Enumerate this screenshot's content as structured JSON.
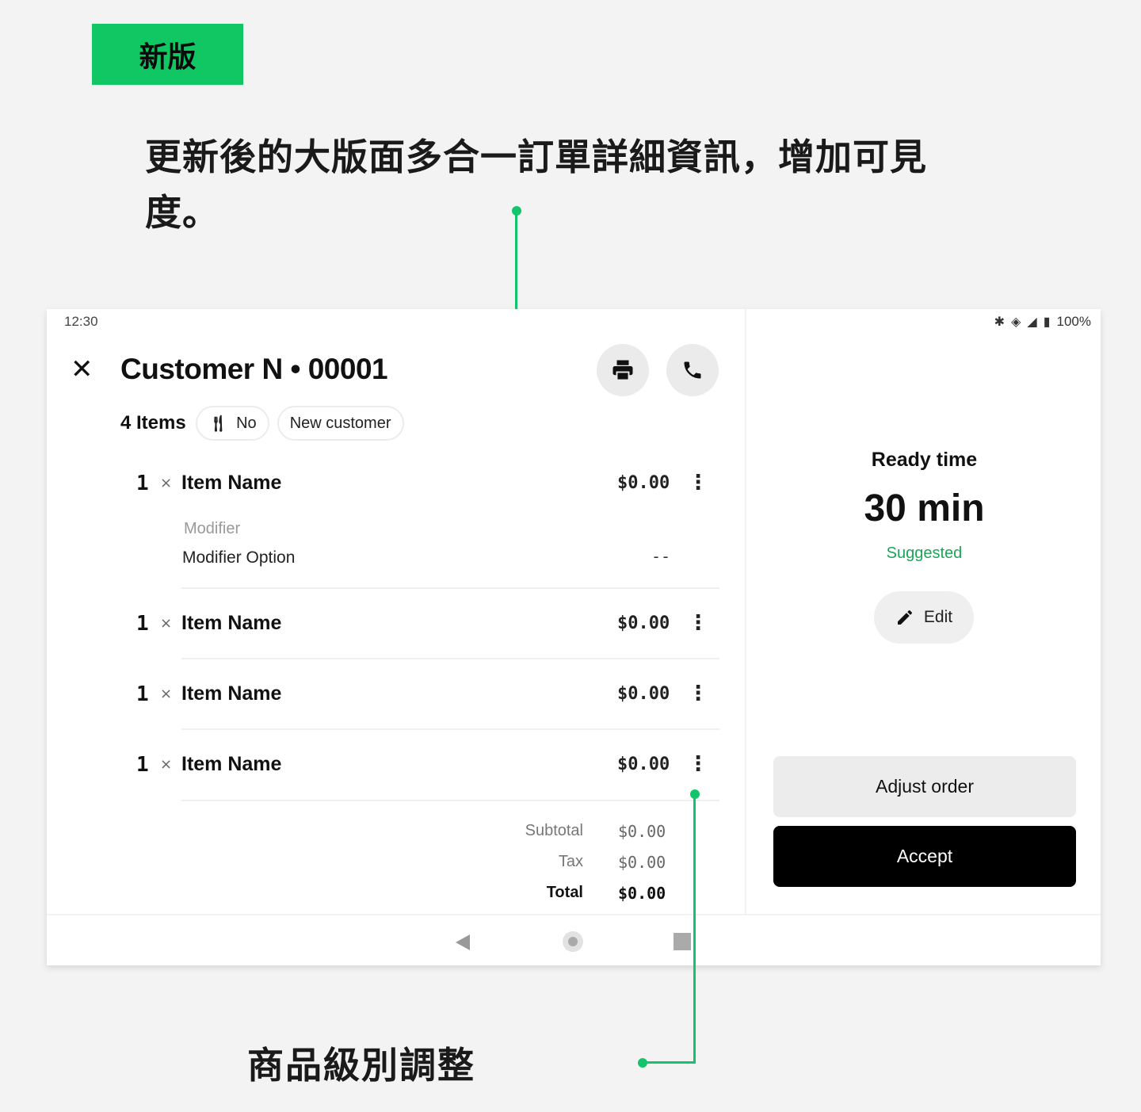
{
  "badge": "新版",
  "headline": "更新後的大版面多合一訂單詳細資訊，增加可見度。",
  "caption": "商品級別調整",
  "status_bar": {
    "time": "12:30",
    "battery": "100%"
  },
  "order": {
    "title": "Customer N • 00001",
    "items_count": "4 Items",
    "utensils_label": "No",
    "customer_tag": "New customer",
    "items": [
      {
        "qty": "1",
        "times": "×",
        "name": "Item Name",
        "price": "$0.00",
        "menu": "⋮"
      },
      {
        "qty": "1",
        "times": "×",
        "name": "Item Name",
        "price": "$0.00",
        "menu": "⋮"
      },
      {
        "qty": "1",
        "times": "×",
        "name": "Item Name",
        "price": "$0.00",
        "menu": "⋮"
      },
      {
        "qty": "1",
        "times": "×",
        "name": "Item Name",
        "price": "$0.00",
        "menu": "⋮"
      }
    ],
    "modifier": {
      "label": "Modifier",
      "option": "Modifier Option",
      "price": "--"
    },
    "summary": {
      "subtotal_label": "Subtotal",
      "subtotal": "$0.00",
      "tax_label": "Tax",
      "tax": "$0.00",
      "total_label": "Total",
      "total": "$0.00"
    }
  },
  "ready": {
    "label": "Ready time",
    "value": "30 min",
    "suggested": "Suggested",
    "edit_label": "Edit"
  },
  "actions": {
    "adjust": "Adjust order",
    "accept": "Accept"
  },
  "colors": {
    "accent_green": "#11c763",
    "suggested_green": "#1aa55a",
    "accept_bg": "#000000"
  },
  "icons": [
    "close-icon",
    "print-icon",
    "phone-icon",
    "utensils-icon",
    "kebab-menu-icon",
    "pencil-icon",
    "nav-back-icon",
    "nav-home-icon",
    "nav-recent-icon",
    "bluetooth-icon",
    "wifi-icon",
    "signal-icon",
    "battery-icon"
  ]
}
